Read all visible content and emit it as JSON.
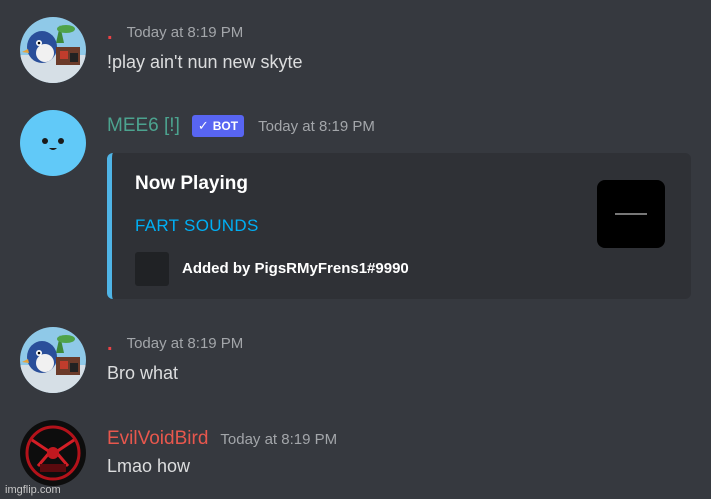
{
  "messages": [
    {
      "username": "",
      "name_dot": ".",
      "timestamp": "Today at 8:19 PM",
      "content": "!play ain't nun new skyte"
    },
    {
      "username": "MEE6 [!]",
      "bot_badge": "BOT",
      "timestamp": "Today at 8:19 PM",
      "embed": {
        "title": "Now Playing",
        "link_text": "FART SOUNDS",
        "footer": "Added by PigsRMyFrens1#9990",
        "accent_color": "#4fb4e6"
      }
    },
    {
      "username": "",
      "name_dot": ".",
      "timestamp": "Today at 8:19 PM",
      "content": "Bro what"
    },
    {
      "username": "EvilVoidBird",
      "timestamp": "Today at 8:19 PM",
      "content": "Lmao how"
    }
  ],
  "colors": {
    "background": "#36393f",
    "bot_name": "#4ca38f",
    "evil_name": "#e8574d",
    "bot_badge": "#5865f2",
    "link": "#00aff4"
  },
  "watermark": "imgflip.com"
}
